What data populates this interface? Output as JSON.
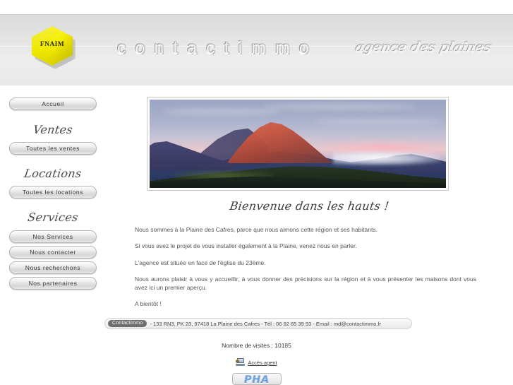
{
  "header": {
    "logo_text": "FNAIM",
    "site_title": "contactimmo",
    "tagline": "agence des plaines"
  },
  "sidebar": {
    "items": [
      {
        "type": "button",
        "label": "Accueil"
      },
      {
        "type": "heading",
        "label": "Ventes"
      },
      {
        "type": "button",
        "label": "Toutes les ventes"
      },
      {
        "type": "heading",
        "label": "Locations"
      },
      {
        "type": "button",
        "label": "Toutes les locations"
      },
      {
        "type": "heading",
        "label": "Services"
      },
      {
        "type": "button",
        "label": "Nos Services"
      },
      {
        "type": "button",
        "label": "Nous contacter"
      },
      {
        "type": "button",
        "label": "Nous recherchons"
      },
      {
        "type": "button",
        "label": "Nos partenaires"
      }
    ]
  },
  "main": {
    "hero_alt": "Panorama de montagne au lever du soleil",
    "welcome_heading": "Bienvenue dans les hauts !",
    "paragraphs": [
      "Nous sommes à la Plaine des Cafres, parce que nous aimons cette région et ses habitants.",
      "Si vous avez le projet de vous installer également à la Plaine, venez nous en parler.",
      "L'agence est située en face de l'église du 23ème.",
      "Nous aurons plaisir à vous y accueillir, à vous donner des précisions sur la région et à vous présenter les maisons dont vous avez ici un premier aperçu.",
      "A bientôt !"
    ]
  },
  "footer": {
    "badge_label": "Contactimmo",
    "contact_line": "- 133 RN3, PK 23, 97418 La Plaine des Cafres - Tél : 06 92 65 39 93 - Email : md@contactimmo.fr",
    "visits_label": "Nombre de visites : 10185",
    "agent_link_label": "Accès agent",
    "agent_icon_name": "computer-icon",
    "pha_badge_label": "PHA"
  },
  "colors": {
    "header_band": "#e6e6e6",
    "logo_yellow": "#f2ec00",
    "text_body": "#555555",
    "footer_badge": "#6e6e6e",
    "pha_blue": "#6da3e0"
  }
}
